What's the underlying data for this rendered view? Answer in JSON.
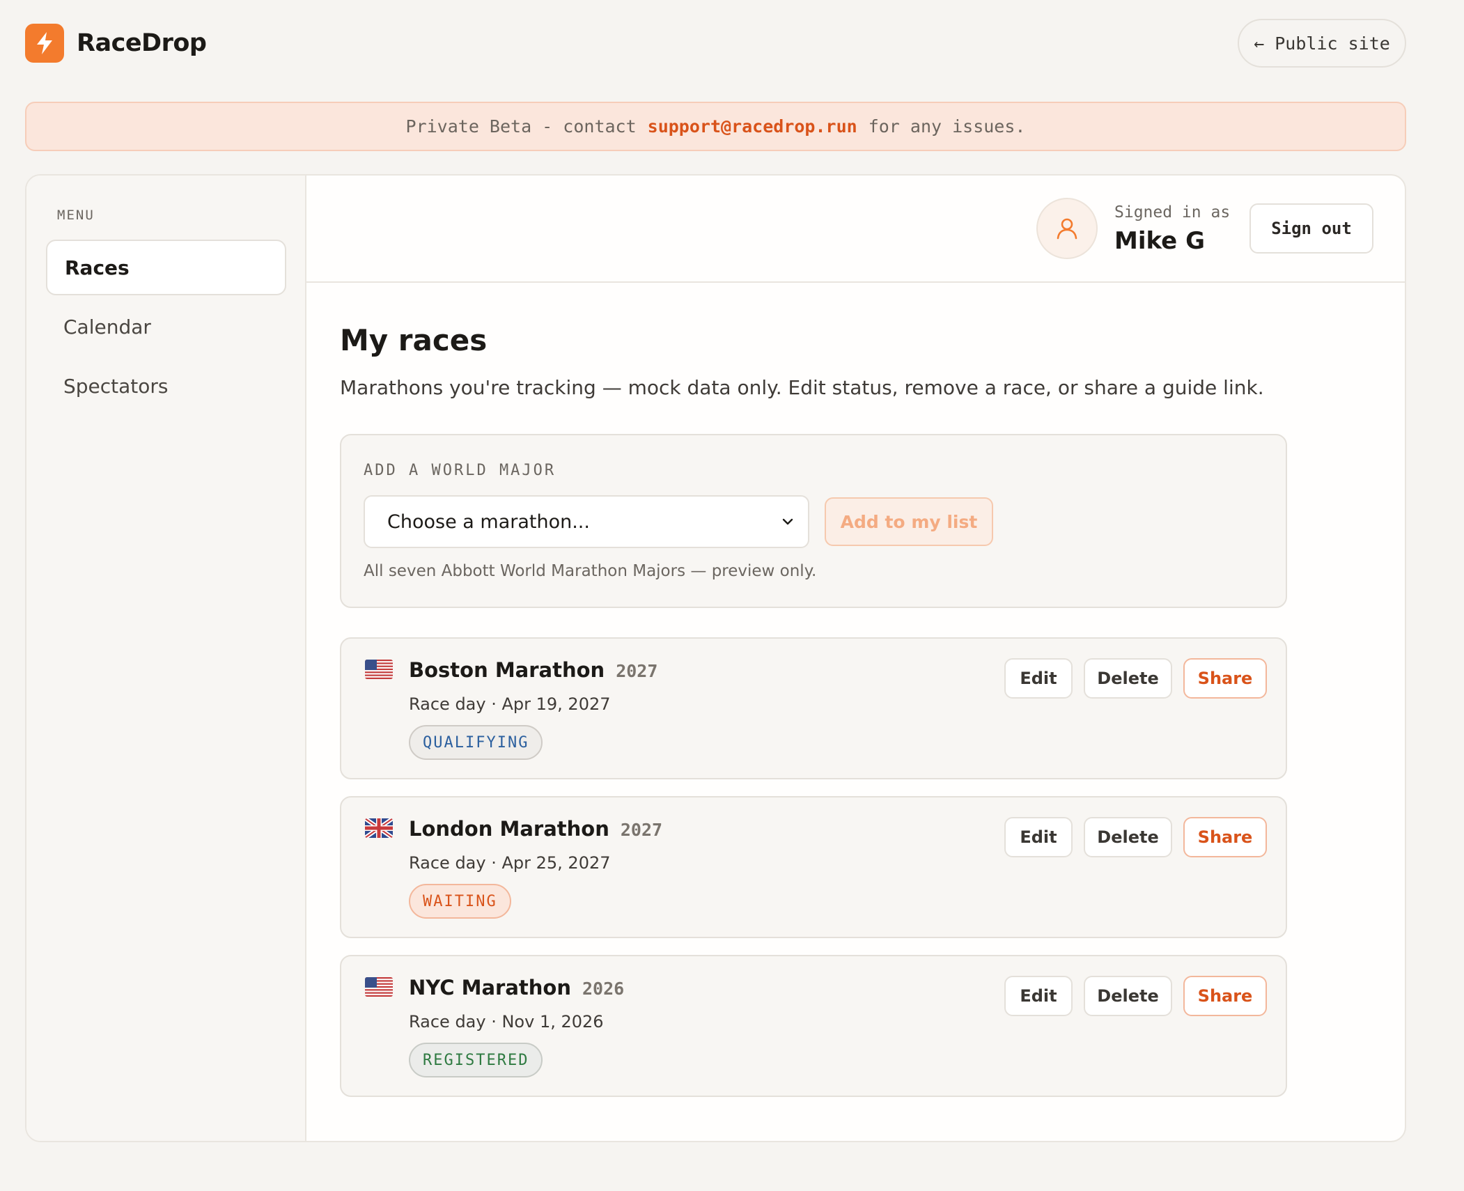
{
  "app": {
    "name": "RaceDrop",
    "public_site_label": "← Public site"
  },
  "banner": {
    "prefix": "Private Beta - contact",
    "email": "support@racedrop.run",
    "suffix": "for any issues."
  },
  "sidebar": {
    "menu_label": "MENU",
    "items": [
      {
        "label": "Races",
        "active": true
      },
      {
        "label": "Calendar",
        "active": false
      },
      {
        "label": "Spectators",
        "active": false
      }
    ]
  },
  "user": {
    "signed_in_label": "Signed in as",
    "name": "Mike G",
    "sign_out_label": "Sign out"
  },
  "main": {
    "title": "My races",
    "subtitle": "Marathons you're tracking — mock data only. Edit status, remove a race, or share a guide link."
  },
  "add_major": {
    "label": "ADD A WORLD MAJOR",
    "select_value": "Choose a marathon...",
    "button_label": "Add to my list",
    "hint": "All seven Abbott World Marathon Majors — preview only."
  },
  "actions": {
    "edit": "Edit",
    "delete": "Delete",
    "share": "Share"
  },
  "races": [
    {
      "name": "Boston Marathon",
      "year": "2027",
      "race_day": "Race day · Apr 19, 2027",
      "status": "QUALIFYING",
      "flag": "us-flag-icon"
    },
    {
      "name": "London Marathon",
      "year": "2027",
      "race_day": "Race day · Apr 25, 2027",
      "status": "WAITING",
      "flag": "uk-flag-icon"
    },
    {
      "name": "NYC Marathon",
      "year": "2026",
      "race_day": "Race day · Nov 1, 2026",
      "status": "REGISTERED",
      "flag": "us-flag-icon"
    }
  ],
  "colors": {
    "accent": "#f37b2d",
    "accent_text": "#d9531a",
    "background": "#f6f4f1"
  }
}
